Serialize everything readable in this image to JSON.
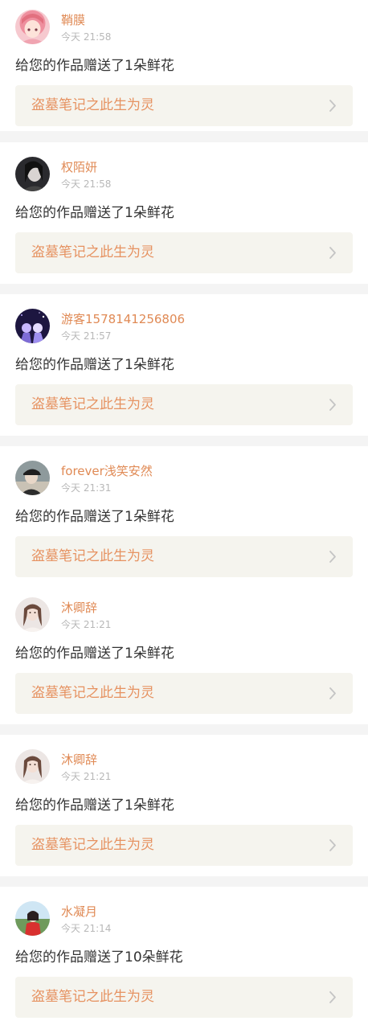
{
  "colors": {
    "accent": "#e69261",
    "username": "#e08a55",
    "time": "#b8b8b8",
    "message": "#333333",
    "link_bg": "#f5f4ee",
    "separator": "#f4f4f4"
  },
  "notifications": [
    {
      "username": "鞘膜",
      "time": "今天 21:58",
      "message": "给您的作品赠送了1朵鲜花",
      "work_title": "盗墓笔记之此生为灵",
      "avatar_icon": "anime-girl-pink-avatar"
    },
    {
      "username": "权陌妍",
      "time": "今天 21:58",
      "message": "给您的作品赠送了1朵鲜花",
      "work_title": "盗墓笔记之此生为灵",
      "avatar_icon": "dark-portrait-avatar"
    },
    {
      "username": "游客1578141256806",
      "time": "今天 21:57",
      "message": "给您的作品赠送了1朵鲜花",
      "work_title": "盗墓笔记之此生为灵",
      "avatar_icon": "night-couple-avatar"
    },
    {
      "username": "forever浅笑安然",
      "time": "今天 21:31",
      "message": "给您的作品赠送了1朵鲜花",
      "work_title": "盗墓笔记之此生为灵",
      "avatar_icon": "photo-person-cap-avatar"
    },
    {
      "username": "沐卿辞",
      "time": "今天 21:21",
      "message": "给您的作品赠送了1朵鲜花",
      "work_title": "盗墓笔记之此生为灵",
      "avatar_icon": "girl-portrait-avatar"
    },
    {
      "username": "沐卿辞",
      "time": "今天 21:21",
      "message": "给您的作品赠送了1朵鲜花",
      "work_title": "盗墓笔记之此生为灵",
      "avatar_icon": "girl-portrait-avatar"
    },
    {
      "username": "水凝月",
      "time": "今天 21:14",
      "message": "给您的作品赠送了10朵鲜花",
      "work_title": "盗墓笔记之此生为灵",
      "avatar_icon": "outdoor-girl-red-avatar"
    }
  ]
}
